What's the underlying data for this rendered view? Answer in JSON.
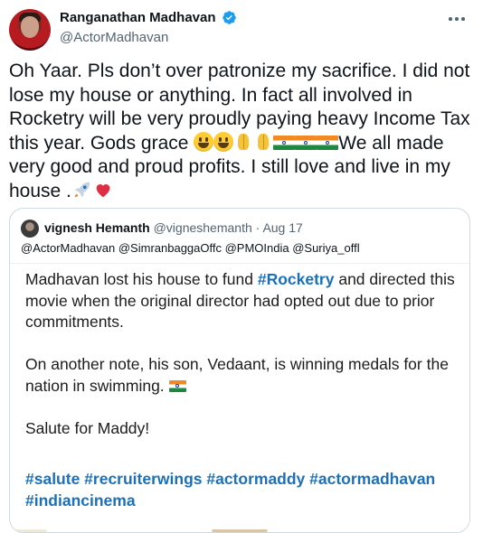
{
  "tweet": {
    "display_name": "Ranganathan Madhavan",
    "handle": "@ActorMadhavan",
    "verified_icon": "verified-badge-icon",
    "more_icon": "more-horizontal-icon",
    "text_parts": {
      "p1": "Oh Yaar. Pls don’t over patronize my sacrifice. I did not lose my house or anything. In fact all involved in Rocketry will be very proudly paying heavy Income Tax this year. Gods grace ",
      "p2": "We all made very good and proud profits. I still love and live in my house .",
      "emoji_sequence": [
        "smiling-face",
        "smiling-face",
        "folded-hands",
        "folded-hands",
        "india-flag",
        "india-flag",
        "india-flag"
      ],
      "end_emojis": [
        "rocket",
        "red-heart"
      ]
    }
  },
  "quoted_tweet": {
    "display_name": "vignesh Hemanth",
    "handle": "@vigneshemanth",
    "separator": " · ",
    "date": "Aug 17",
    "mentions": "@ActorMadhavan @SimranbaggaOffc @PMOIndia @Suriya_offl",
    "image_text": {
      "line1_a": "Madhavan lost his house to fund ",
      "line1_tag": "#Rocketry",
      "line1_b": " and directed this movie when the original director had opted out due to prior commitments.",
      "para2": "On another note, his son, Vedaant, is winning medals for the nation in swimming. ",
      "para3": "Salute for Maddy!",
      "hashtags": "#salute #recruiterwings #actormaddy #actormadhavan #indiancinema"
    }
  },
  "colors": {
    "text": "#0f1419",
    "muted": "#536471",
    "verified": "#1d9bf0",
    "hashtag": "#1d6fb8",
    "border": "#cfd9de"
  }
}
